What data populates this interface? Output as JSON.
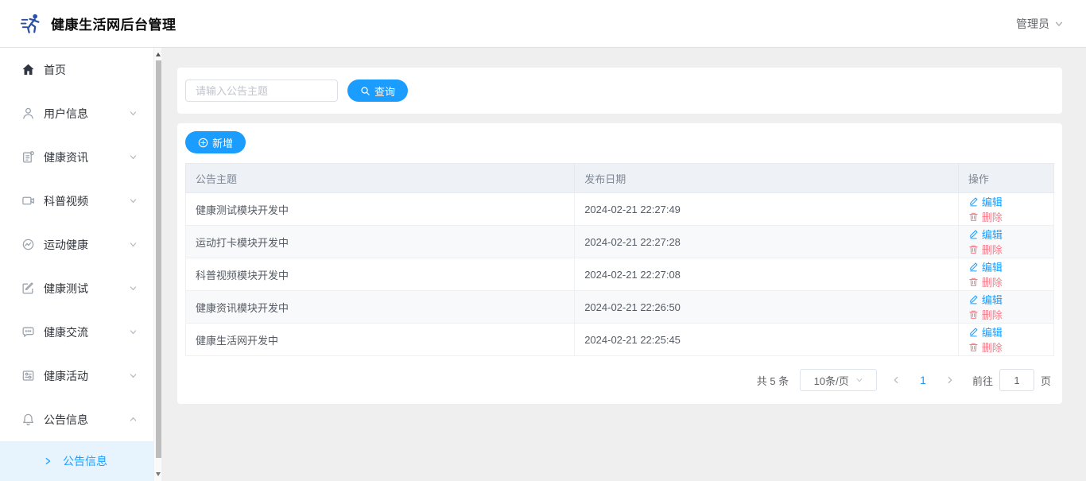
{
  "header": {
    "title": "健康生活网后台管理",
    "admin_label": "管理员"
  },
  "sidebar": {
    "items": [
      {
        "key": "home",
        "label": "首页",
        "icon": "home-icon",
        "expandable": false,
        "expanded": false
      },
      {
        "key": "users",
        "label": "用户信息",
        "icon": "user-icon",
        "expandable": true,
        "expanded": false
      },
      {
        "key": "news",
        "label": "健康资讯",
        "icon": "news-icon",
        "expandable": true,
        "expanded": false
      },
      {
        "key": "videos",
        "label": "科普视频",
        "icon": "video-icon",
        "expandable": true,
        "expanded": false
      },
      {
        "key": "sport",
        "label": "运动健康",
        "icon": "sport-icon",
        "expandable": true,
        "expanded": false
      },
      {
        "key": "test",
        "label": "健康测试",
        "icon": "edit-icon",
        "expandable": true,
        "expanded": false
      },
      {
        "key": "chat",
        "label": "健康交流",
        "icon": "chat-icon",
        "expandable": true,
        "expanded": false
      },
      {
        "key": "activity",
        "label": "健康活动",
        "icon": "activity-icon",
        "expandable": true,
        "expanded": false
      },
      {
        "key": "notice",
        "label": "公告信息",
        "icon": "bell-icon",
        "expandable": true,
        "expanded": true
      }
    ],
    "submenu": {
      "label": "公告信息"
    }
  },
  "search": {
    "placeholder": "请输入公告主题",
    "button_label": "查询"
  },
  "toolbar": {
    "add_label": "新增"
  },
  "table": {
    "columns": [
      "公告主题",
      "发布日期",
      "操作"
    ],
    "edit_label": "编辑",
    "delete_label": "删除",
    "rows": [
      {
        "subject": "健康测试模块开发中",
        "date": "2024-02-21 22:27:49"
      },
      {
        "subject": "运动打卡模块开发中",
        "date": "2024-02-21 22:27:28"
      },
      {
        "subject": "科普视频模块开发中",
        "date": "2024-02-21 22:27:08"
      },
      {
        "subject": "健康资讯模块开发中",
        "date": "2024-02-21 22:26:50"
      },
      {
        "subject": "健康生活网开发中",
        "date": "2024-02-21 22:25:45"
      }
    ]
  },
  "pagination": {
    "total_text": "共 5 条",
    "page_size": "10条/页",
    "current_page": "1",
    "goto_label": "前往",
    "goto_value": "1",
    "page_suffix": "页"
  },
  "colors": {
    "primary": "#1b9dff",
    "link_blue": "#1e9fff",
    "danger": "#f77c8a",
    "main_bg": "#efefef",
    "table_header_bg": "#eef2f7",
    "submenu_bg": "#e7f3fd"
  }
}
